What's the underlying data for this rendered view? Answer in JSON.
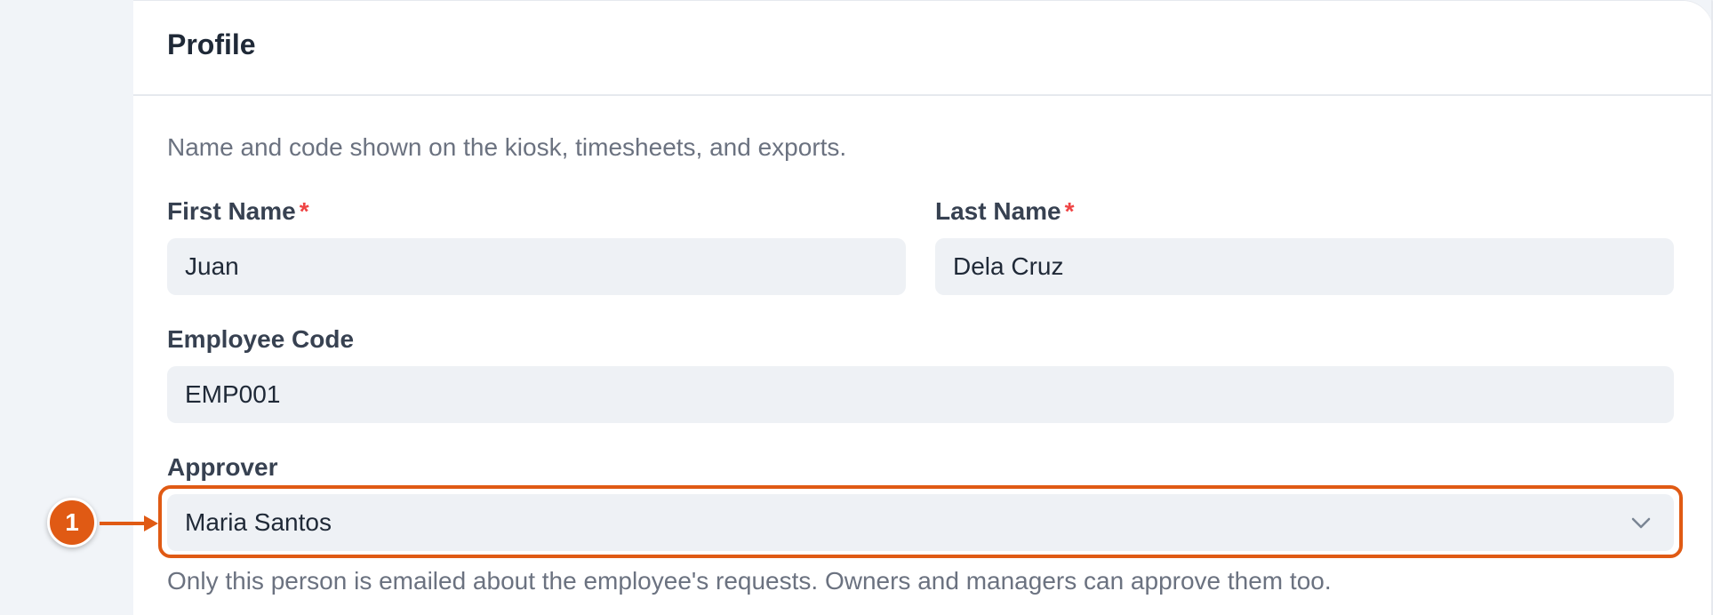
{
  "card": {
    "title": "Profile",
    "description": "Name and code shown on the kiosk, timesheets, and exports."
  },
  "fields": {
    "first_name": {
      "label": "First Name",
      "required_mark": "*",
      "value": "Juan"
    },
    "last_name": {
      "label": "Last Name",
      "required_mark": "*",
      "value": "Dela Cruz"
    },
    "employee_code": {
      "label": "Employee Code",
      "value": "EMP001"
    },
    "approver": {
      "label": "Approver",
      "value": "Maria Santos",
      "icon": "chevron-down-icon",
      "help": "Only this person is emailed about the employee's requests. Owners and managers can approve them too."
    }
  },
  "callout": {
    "number": "1"
  },
  "colors": {
    "accent": "#e05a14",
    "required": "#ef4444",
    "field_bg": "#eef1f5",
    "muted_text": "#6b7280"
  }
}
